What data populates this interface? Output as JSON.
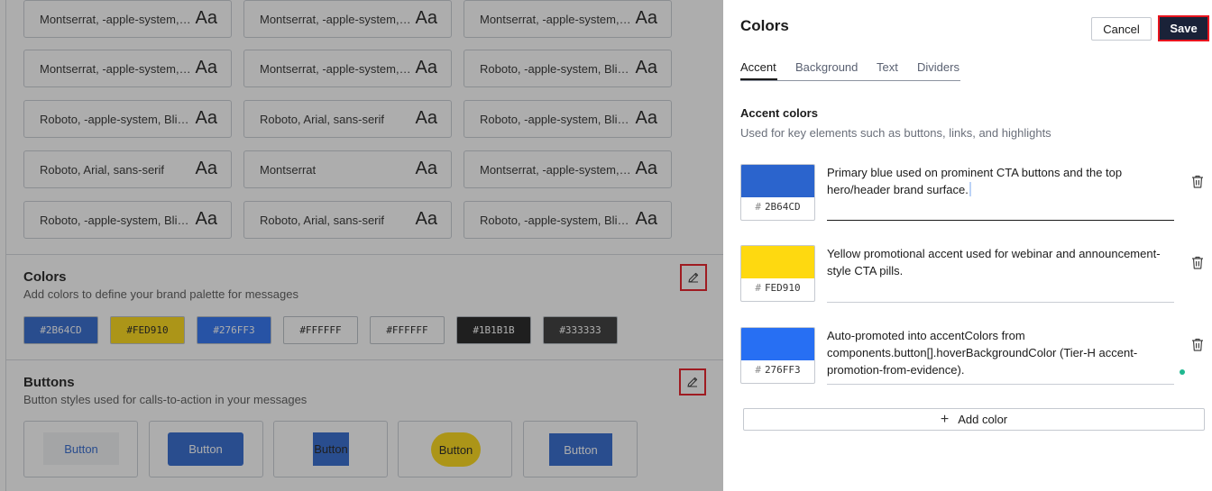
{
  "background": {
    "fonts": [
      {
        "name": "Montserrat, -apple-system, BlinkMacSystemFont",
        "sample": "Aa"
      },
      {
        "name": "Montserrat, -apple-system, BlinkMacSystemFont",
        "sample": "Aa"
      },
      {
        "name": "Montserrat, -apple-system, BlinkMacSystemFont",
        "sample": "Aa"
      },
      {
        "name": "Montserrat, -apple-system, BlinkMacSystemFont",
        "sample": "Aa"
      },
      {
        "name": "Montserrat, -apple-system, BlinkMacSystemFont",
        "sample": "Aa"
      },
      {
        "name": "Roboto, -apple-system, BlinkMacSystemFont",
        "sample": "Aa"
      },
      {
        "name": "Roboto, -apple-system, BlinkMacSystemFont",
        "sample": "Aa"
      },
      {
        "name": "Roboto, Arial, sans-serif",
        "sample": "Aa"
      },
      {
        "name": "Roboto, -apple-system, BlinkMacSystemFont",
        "sample": "Aa"
      },
      {
        "name": "Roboto, Arial, sans-serif",
        "sample": "Aa"
      },
      {
        "name": "Montserrat",
        "sample": "Aa"
      },
      {
        "name": "Montserrat, -apple-system, BlinkMacSystemFont",
        "sample": "Aa"
      },
      {
        "name": "Roboto, -apple-system, BlinkMacSystemFont",
        "sample": "Aa"
      },
      {
        "name": "Roboto, Arial, sans-serif",
        "sample": "Aa"
      },
      {
        "name": "Roboto, -apple-system, BlinkMacSystemFont",
        "sample": "Aa"
      }
    ],
    "colors_section": {
      "title": "Colors",
      "subtitle": "Add colors to define your brand palette for messages",
      "swatches": [
        {
          "label": "#2B64CD",
          "bg": "#2B64CD",
          "fg": "#ffffff"
        },
        {
          "label": "#FED910",
          "bg": "#FED910",
          "fg": "#1b1b1b"
        },
        {
          "label": "#276FF3",
          "bg": "#276FF3",
          "fg": "#ffffff"
        },
        {
          "label": "#FFFFFF",
          "bg": "#FFFFFF",
          "fg": "#1b1b1b"
        },
        {
          "label": "#FFFFFF",
          "bg": "#FFFFFF",
          "fg": "#1b1b1b"
        },
        {
          "label": "#1B1B1B",
          "bg": "#1B1B1B",
          "fg": "#ffffff"
        },
        {
          "label": "#333333",
          "bg": "#333333",
          "fg": "#ffffff"
        }
      ]
    },
    "buttons_section": {
      "title": "Buttons",
      "subtitle": "Button styles used for calls-to-action in your messages",
      "buttons": [
        {
          "label": "Button"
        },
        {
          "label": "Button"
        },
        {
          "label": "Button"
        },
        {
          "label": "Button"
        },
        {
          "label": "Button"
        }
      ]
    }
  },
  "panel": {
    "title": "Colors",
    "cancel_label": "Cancel",
    "save_label": "Save",
    "tabs": [
      {
        "label": "Accent",
        "active": true
      },
      {
        "label": "Background",
        "active": false
      },
      {
        "label": "Text",
        "active": false
      },
      {
        "label": "Dividers",
        "active": false
      }
    ],
    "accent": {
      "title": "Accent colors",
      "subtitle": "Used for key elements such as buttons, links, and highlights",
      "colors": [
        {
          "hex": "2B64CD",
          "color": "#2B64CD",
          "description": "Primary blue used on prominent CTA buttons and the top hero/header brand surface."
        },
        {
          "hex": "FED910",
          "color": "#FED910",
          "description": "Yellow promotional accent used for webinar and announcement-style CTA pills."
        },
        {
          "hex": "276FF3",
          "color": "#276FF3",
          "description": "Auto-promoted into accentColors from components.button[].hoverBackgroundColor (Tier-H accent-promotion-from-evidence)."
        }
      ],
      "add_label": "Add color"
    }
  }
}
